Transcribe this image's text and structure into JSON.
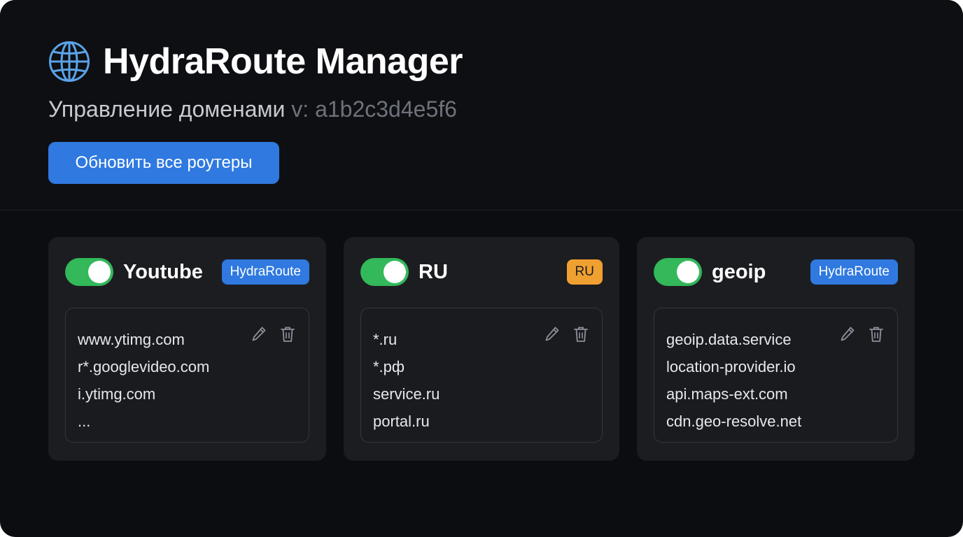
{
  "app": {
    "title": "HydraRoute Manager",
    "subtitle": "Управление доменами",
    "version": "v: a1b2c3d4e5f6",
    "update_button": "Обновить все роутеры",
    "icon": "globe-icon"
  },
  "colors": {
    "background": "#0c0d11",
    "card": "#1c1d21",
    "accent_blue": "#2f79e0",
    "toggle_on": "#33b85a",
    "badge_orange": "#f0a030"
  },
  "cards": [
    {
      "name": "Youtube",
      "enabled": true,
      "badge": "HydraRoute",
      "badge_color": "#2f79e0",
      "domains": [
        "www.ytimg.com",
        "r*.googlevideo.com",
        "i.ytimg.com",
        "..."
      ]
    },
    {
      "name": "RU",
      "enabled": true,
      "badge": "RU",
      "badge_color": "#f0a030",
      "domains": [
        "*.ru",
        "*.рф",
        "service.ru",
        "portal.ru"
      ]
    },
    {
      "name": "geoip",
      "enabled": true,
      "badge": "HydraRoute",
      "badge_color": "#2f79e0",
      "domains": [
        "geoip.data.service",
        "location-provider.io",
        "api.maps-ext.com",
        "cdn.geo-resolve.net"
      ]
    }
  ]
}
